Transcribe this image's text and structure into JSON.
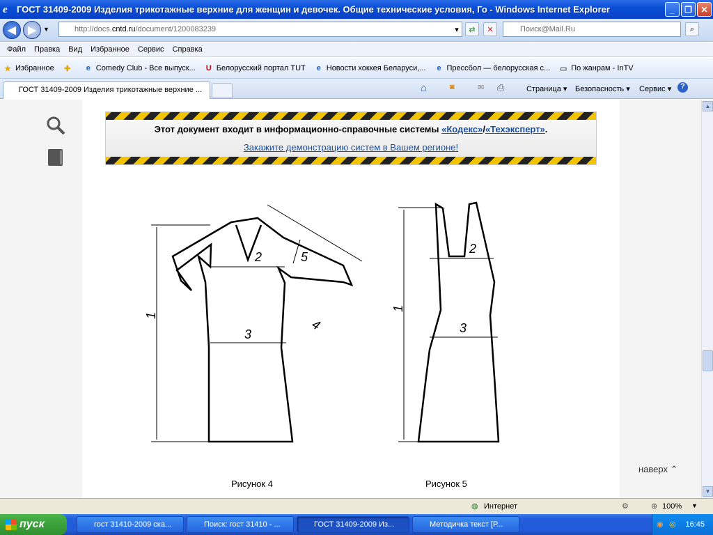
{
  "window": {
    "title": "ГОСТ 31409-2009 Изделия трикотажные верхние для женщин и девочек. Общие технические условия, Го - Windows Internet Explorer"
  },
  "address": {
    "url_prefix": "http://docs.",
    "url_domain": "cntd.ru",
    "url_path": "/document/1200083239"
  },
  "search": {
    "placeholder": "Поиск@Mail.Ru"
  },
  "menu": [
    "Файл",
    "Правка",
    "Вид",
    "Избранное",
    "Сервис",
    "Справка"
  ],
  "favorites": {
    "label": "Избранное",
    "items": [
      "Comedy Club - Все выпуск...",
      "Белорусский портал TUT",
      "Новости хоккея Беларуси,...",
      "Прессбол — белорусская с...",
      "По жанрам - InTV"
    ]
  },
  "tab": {
    "label": "ГОСТ 31409-2009 Изделия трикотажные верхние ..."
  },
  "commands": {
    "page": "Страница",
    "security": "Безопасность",
    "tools": "Сервис"
  },
  "banner": {
    "text": "Этот документ входит в информационно-справочные системы ",
    "kodeks": "«Кодекс»",
    "sep": "/",
    "tech": "«Техэксперт»",
    "dot": ".",
    "link": "Закажите демонстрацию систем в Вашем регионе!"
  },
  "figures": {
    "fig4": {
      "caption": "Рисунок 4",
      "labels": [
        "1",
        "2",
        "3",
        "4",
        "5"
      ]
    },
    "fig5": {
      "caption": "Рисунок 5",
      "labels": [
        "1",
        "2",
        "3"
      ]
    }
  },
  "naverh": "наверх",
  "status": {
    "zone": "Интернет",
    "zoom": "100%"
  },
  "taskbar": {
    "start": "пуск",
    "tasks": [
      "гост 31410-2009 ска...",
      "Поиск: гост 31410 - ...",
      "ГОСТ 31409-2009 Из...",
      "Методичка текст [Р..."
    ],
    "clock": "16:45"
  }
}
